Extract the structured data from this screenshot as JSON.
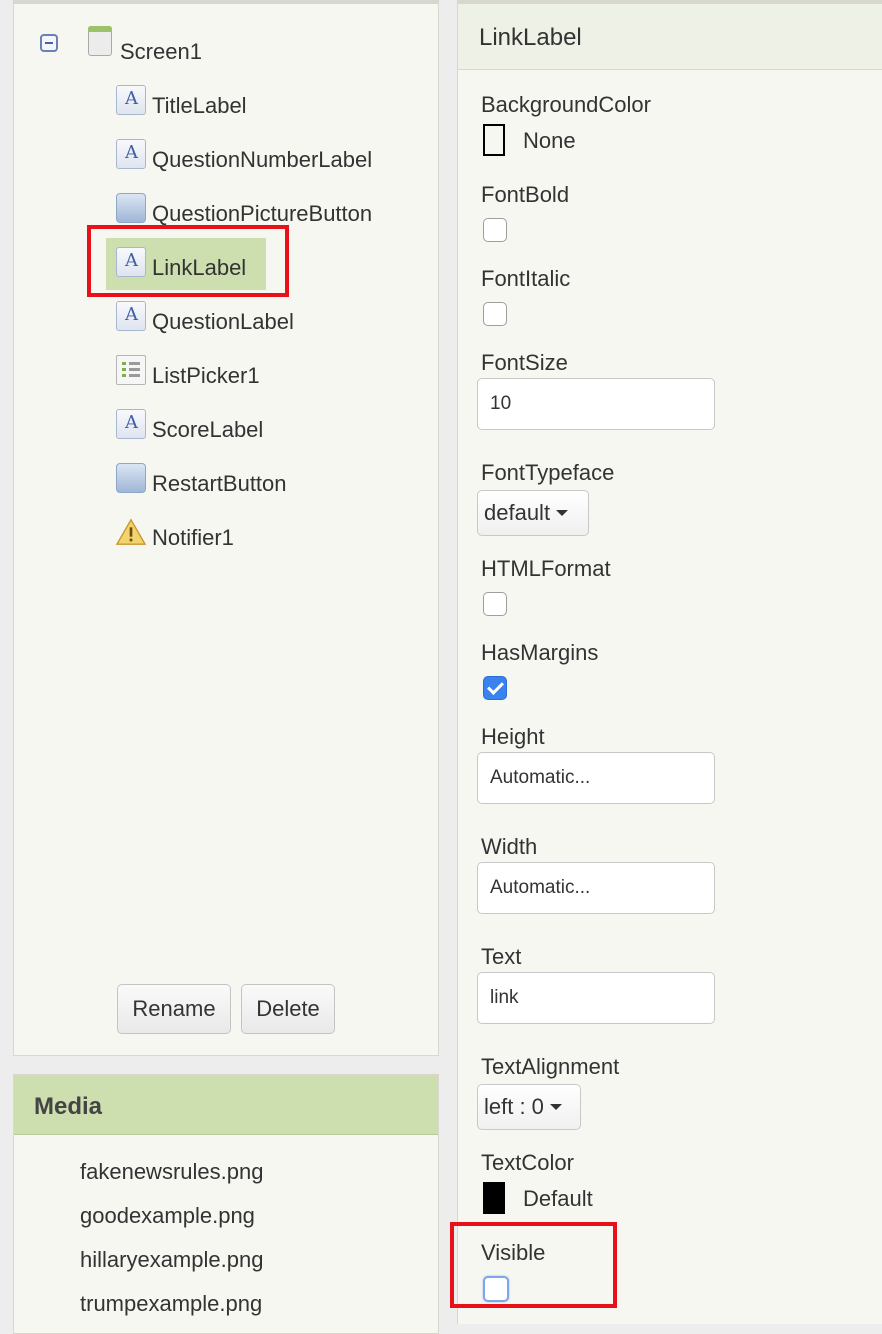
{
  "components": {
    "root": {
      "label": "Screen1",
      "icon": "screen-icon",
      "toggle_icon": "collapse-icon"
    },
    "items": [
      {
        "label": "TitleLabel",
        "icon": "label-icon"
      },
      {
        "label": "QuestionNumberLabel",
        "icon": "label-icon"
      },
      {
        "label": "QuestionPictureButton",
        "icon": "button-icon"
      },
      {
        "label": "LinkLabel",
        "icon": "label-icon",
        "selected": true
      },
      {
        "label": "QuestionLabel",
        "icon": "label-icon"
      },
      {
        "label": "ListPicker1",
        "icon": "listpicker-icon"
      },
      {
        "label": "ScoreLabel",
        "icon": "label-icon"
      },
      {
        "label": "RestartButton",
        "icon": "button-icon"
      },
      {
        "label": "Notifier1",
        "icon": "warning-icon"
      }
    ],
    "rename_label": "Rename",
    "delete_label": "Delete"
  },
  "media": {
    "title": "Media",
    "files": [
      "fakenewsrules.png",
      "goodexample.png",
      "hillaryexample.png",
      "trumpexample.png"
    ]
  },
  "properties": {
    "title": "LinkLabel",
    "background_color": {
      "label": "BackgroundColor",
      "value": "None",
      "swatch": "#ffffff"
    },
    "font_bold": {
      "label": "FontBold",
      "checked": false
    },
    "font_italic": {
      "label": "FontItalic",
      "checked": false
    },
    "font_size": {
      "label": "FontSize",
      "value": "10"
    },
    "font_typeface": {
      "label": "FontTypeface",
      "value": "default"
    },
    "html_format": {
      "label": "HTMLFormat",
      "checked": false
    },
    "has_margins": {
      "label": "HasMargins",
      "checked": true
    },
    "height": {
      "label": "Height",
      "value": "Automatic..."
    },
    "width": {
      "label": "Width",
      "value": "Automatic..."
    },
    "text": {
      "label": "Text",
      "value": "link"
    },
    "text_alignment": {
      "label": "TextAlignment",
      "value": "left : 0"
    },
    "text_color": {
      "label": "TextColor",
      "value": "Default",
      "swatch": "#000000"
    },
    "visible": {
      "label": "Visible",
      "checked": false
    }
  },
  "colors": {
    "selection": "#cddfaf",
    "highlight_box": "#e8111a",
    "checkbox_checked": "#3a82ee"
  }
}
